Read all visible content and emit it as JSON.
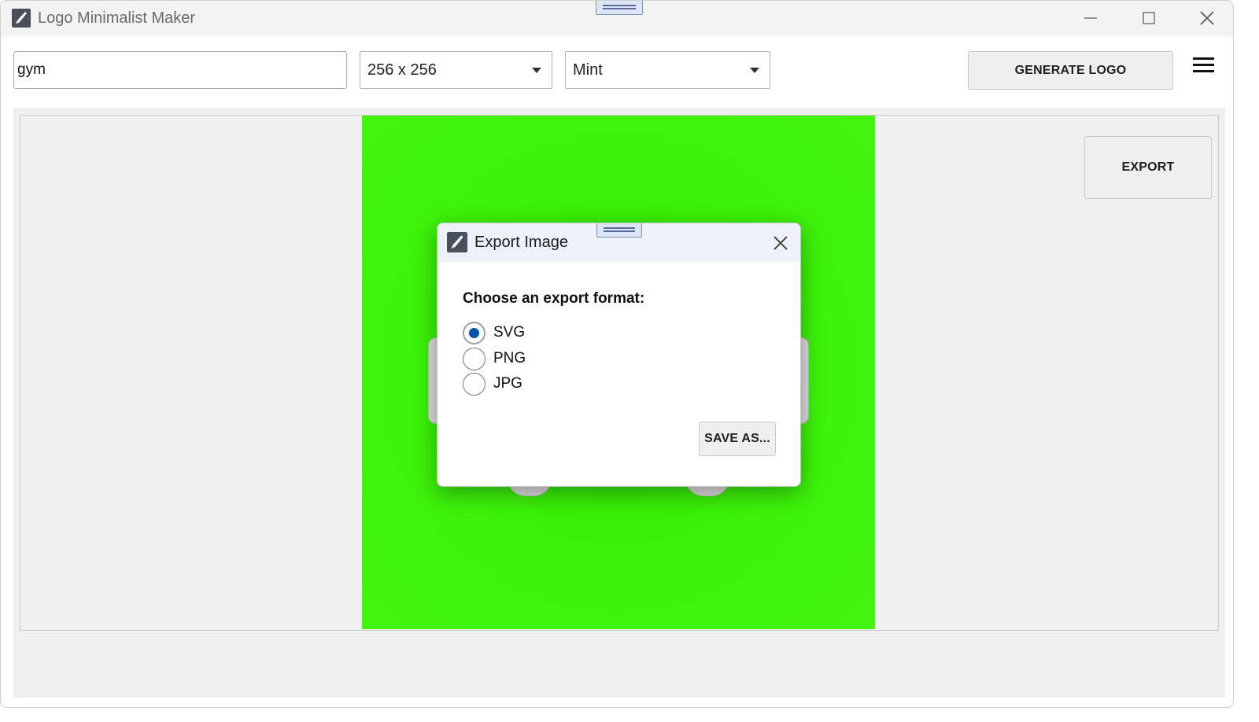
{
  "app": {
    "title": "Logo Minimalist Maker",
    "icon": "pen-nib-icon"
  },
  "window_controls": {
    "minimize_icon": "minimize-icon",
    "maximize_icon": "maximize-icon",
    "close_icon": "close-icon"
  },
  "toolbar": {
    "keyword_value": "gym",
    "size_select": {
      "selected": "256 x 256"
    },
    "theme_select": {
      "selected": "Mint"
    },
    "generate_label": "GENERATE LOGO",
    "menu_icon": "hamburger-menu-icon"
  },
  "canvas": {
    "background_color": "#3df20a",
    "export_label": "EXPORT"
  },
  "dialog": {
    "title": "Export Image",
    "prompt": "Choose an export format:",
    "options": [
      {
        "label": "SVG",
        "checked": true
      },
      {
        "label": "PNG",
        "checked": false
      },
      {
        "label": "JPG",
        "checked": false
      }
    ],
    "save_label": "SAVE AS...",
    "accent_color": "#0054a6"
  }
}
